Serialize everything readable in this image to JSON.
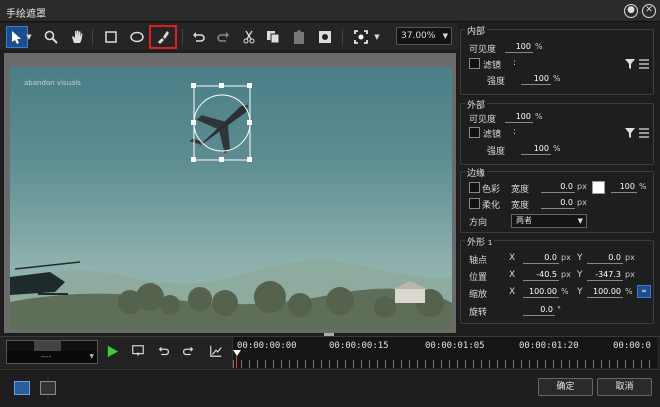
{
  "window": {
    "title": "手绘遮罩"
  },
  "toolbar": {
    "zoom": "37.00%",
    "tools": [
      "pointer-icon",
      "magnifier-icon",
      "hand-icon",
      "rect-icon",
      "ellipse-icon",
      "brush-icon",
      "undo-icon",
      "redo-icon",
      "cut-icon",
      "copy-icon",
      "paste-icon",
      "keyframe-icon",
      "fit-icon"
    ]
  },
  "preview": {
    "watermark": "abandon visuals"
  },
  "inner": {
    "title": "内部",
    "visibility_label": "可见度",
    "visibility_value": "100",
    "visibility_unit": "%",
    "filter_label": "滤镜",
    "filter_colon": ":",
    "strength_label": "强度",
    "strength_value": "100",
    "strength_unit": "%"
  },
  "outer": {
    "title": "外部",
    "visibility_label": "可见度",
    "visibility_value": "100",
    "visibility_unit": "%",
    "filter_label": "滤镜",
    "filter_colon": ":",
    "strength_label": "强度",
    "strength_value": "100",
    "strength_unit": "%"
  },
  "edge": {
    "title": "边缘",
    "color_label": "色彩",
    "color_width_label": "宽度",
    "color_width_value": "0.0",
    "color_width_unit": "px",
    "color_opacity_value": "100",
    "color_opacity_unit": "%",
    "soft_label": "柔化",
    "soft_width_label": "宽度",
    "soft_width_value": "0.0",
    "soft_width_unit": "px",
    "direction_label": "方向",
    "direction_value": "两者"
  },
  "shape": {
    "title": "外形",
    "title_index": "1",
    "anchor_label": "轴点",
    "anchor_x_label": "X",
    "anchor_x": "0.0",
    "anchor_x_unit": "px",
    "anchor_y_label": "Y",
    "anchor_y": "0.0",
    "anchor_y_unit": "px",
    "pos_label": "位置",
    "pos_x_label": "X",
    "pos_x": "-40.5",
    "pos_x_unit": "px",
    "pos_y_label": "Y",
    "pos_y": "-347.3",
    "pos_y_unit": "px",
    "scale_label": "缩放",
    "scale_x_label": "X",
    "scale_x": "100.00",
    "scale_x_unit": "%",
    "scale_y_label": "Y",
    "scale_y": "100.00",
    "scale_y_unit": "%",
    "rotate_label": "旋转",
    "rotate_value": "0.0",
    "rotate_unit": "°"
  },
  "timeline": {
    "timecode_placeholder": "----",
    "labels": [
      "00:00:00:00",
      "00:00:00:15",
      "00:00:01:05",
      "00:00:01:20",
      "00:00:0"
    ]
  },
  "footer": {
    "ok": "确定",
    "cancel": "取消"
  }
}
